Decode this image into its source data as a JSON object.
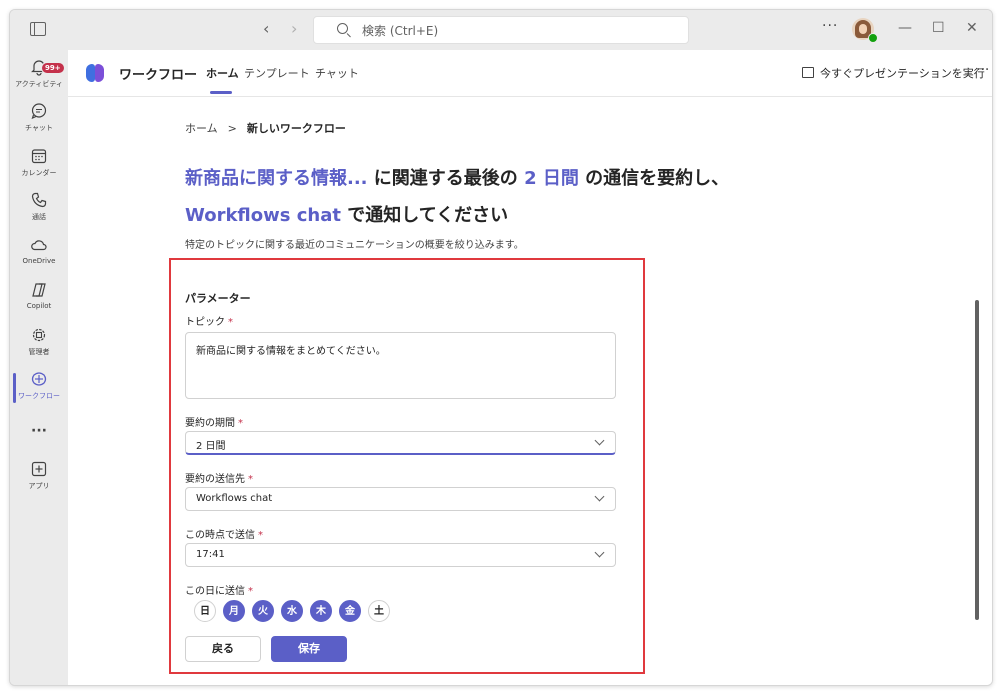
{
  "titlebar": {
    "search_placeholder": "検索 (Ctrl+E)",
    "more": "···",
    "back": "‹",
    "forward": "›",
    "minimize": "—",
    "maximize": "☐",
    "close": "✕"
  },
  "rail": {
    "badge": "99+",
    "items": [
      {
        "label": "アクティビティ",
        "icon": "bell-icon"
      },
      {
        "label": "チャット",
        "icon": "chat-icon"
      },
      {
        "label": "カレンダー",
        "icon": "calendar-icon"
      },
      {
        "label": "通話",
        "icon": "phone-icon"
      },
      {
        "label": "OneDrive",
        "icon": "cloud-icon"
      },
      {
        "label": "Copilot",
        "icon": "copilot-icon"
      },
      {
        "label": "管理者",
        "icon": "admin-icon"
      },
      {
        "label": "ワークフロー",
        "icon": "workflow-icon"
      },
      {
        "label": "···",
        "icon": "more-icon"
      },
      {
        "label": "アプリ",
        "icon": "add-app-icon"
      }
    ]
  },
  "appbar": {
    "title": "ワークフロー",
    "tabs": [
      "ホーム",
      "テンプレート",
      "チャット"
    ],
    "present": "今すぐプレゼンテーションを実行",
    "more": "···"
  },
  "breadcrumb": {
    "home": "ホーム",
    "sep": ">",
    "current": "新しいワークフロー"
  },
  "headline": {
    "topic": "新商品に関する情報...",
    "mid": " に関連する最後の ",
    "period": "2 日間",
    "tail": " の通信を要約し、",
    "dest": "Workflows chat",
    "end": " で通知してください"
  },
  "description": "特定のトピックに関する最近のコミュニケーションの概要を絞り込みます。",
  "form": {
    "section_title": "パラメーター",
    "required_mark": "*",
    "topic_label": "トピック",
    "topic_value": "新商品に関する情報をまとめてください。",
    "period_label": "要約の期間",
    "period_value": "2 日間",
    "dest_label": "要約の送信先",
    "dest_value": "Workflows chat",
    "time_label": "この時点で送信",
    "time_value": "17:41",
    "days_label": "この日に送信",
    "days": [
      {
        "label": "日",
        "selected": false
      },
      {
        "label": "月",
        "selected": true
      },
      {
        "label": "火",
        "selected": true
      },
      {
        "label": "水",
        "selected": true
      },
      {
        "label": "木",
        "selected": true
      },
      {
        "label": "金",
        "selected": true
      },
      {
        "label": "土",
        "selected": false
      }
    ],
    "back_button": "戻る",
    "save_button": "保存"
  },
  "colors": {
    "accent": "#5b5fc7",
    "highlight_border": "#e0393e",
    "badge": "#c4314b"
  }
}
